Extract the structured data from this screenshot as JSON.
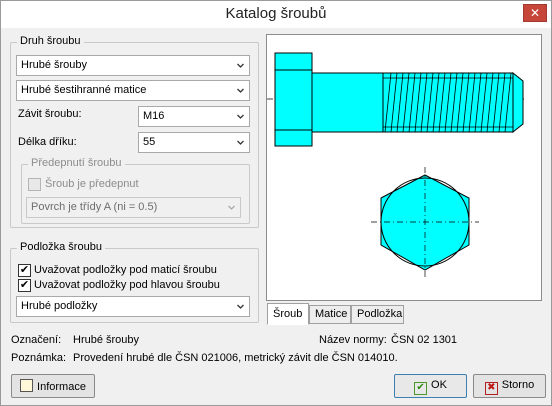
{
  "window": {
    "title": "Katalog šroubů",
    "close_label": "✕"
  },
  "druh": {
    "title": "Druh šroubu",
    "type_combo": "Hrubé šrouby",
    "nut_combo": "Hrubé šestihranné matice",
    "thread_label": "Závit šroubu:",
    "thread_value": "M16",
    "length_label": "Délka dříku:",
    "length_value": "55",
    "preload": {
      "title": "Předepnutí šroubu",
      "check_label": "Šroub je předepnut",
      "checked": false,
      "surface_combo": "Povrch je třídy A (ni = 0.5)"
    }
  },
  "washer": {
    "title": "Podložka šroubu",
    "check_nut_label": "Uvažovat podložky pod maticí šroubu",
    "check_nut": true,
    "check_head_label": "Uvažovat podložky pod hlavou šroubu",
    "check_head": true,
    "combo": "Hrubé podložky"
  },
  "tabs": [
    "Šroub",
    "Matice",
    "Podložka"
  ],
  "active_tab": 0,
  "info": {
    "oznaceni_label": "Označení:",
    "oznaceni_value": "Hrubé šrouby",
    "norma_label": "Název normy:",
    "norma_value": "ČSN 02 1301",
    "poznamka_label": "Poznámka:",
    "poznamka_value": "Provedení hrubé dle ČSN 021006, metrický závit dle ČSN 014010."
  },
  "buttons": {
    "informace": "Informace",
    "ok": "OK",
    "storno": "Storno"
  },
  "colors": {
    "bolt_fill": "#00ffff",
    "outline": "#000000",
    "window_bg": "#f0f0f0"
  }
}
